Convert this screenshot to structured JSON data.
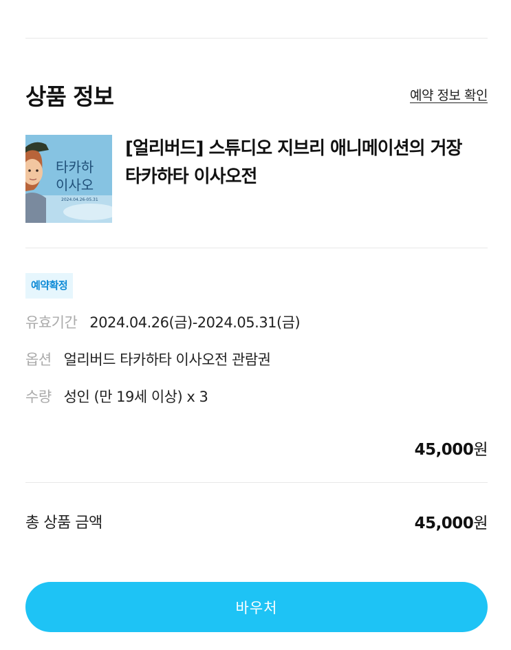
{
  "section": {
    "title": "상품 정보",
    "link": "예약 정보 확인"
  },
  "product": {
    "name": "[얼리버드] 스튜디오 지브리 애니메이션의 거장 타카하타 이사오전",
    "poster": {
      "title": "타카하타 이사오",
      "dates": "2024.04.26-05.31"
    }
  },
  "status_badge": "예약확정",
  "details": [
    {
      "label": "유효기간",
      "value": "2024.04.26(금)-2024.05.31(금)"
    },
    {
      "label": "옵션",
      "value": "얼리버드 타카하타 이사오전 관람권"
    },
    {
      "label": "수량",
      "value": "성인 (만 19세 이상) x 3"
    }
  ],
  "item_price": {
    "amount": "45,000",
    "unit": "원"
  },
  "total": {
    "label": "총 상품 금액",
    "amount": "45,000",
    "unit": "원"
  },
  "voucher_button": "바우처",
  "colors": {
    "accent": "#1ec3f5",
    "badge_bg": "#e6f6fd",
    "badge_text": "#0d8ad6"
  }
}
